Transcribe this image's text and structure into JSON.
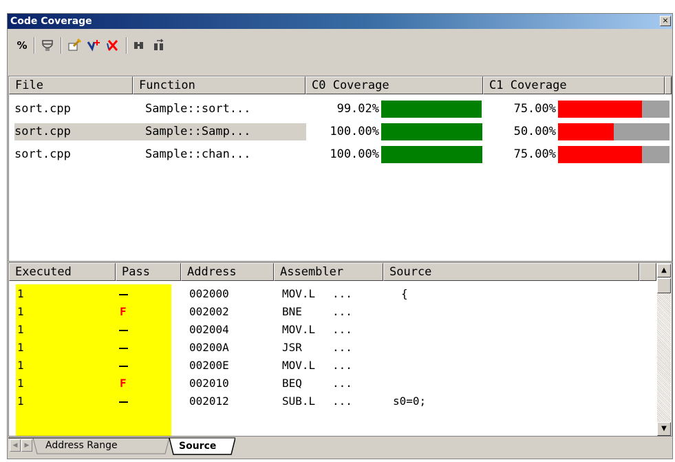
{
  "window": {
    "title": "Code Coverage",
    "close_glyph": "×"
  },
  "toolbar": {
    "buttons": [
      {
        "name": "percent-icon",
        "glyph": "%"
      },
      {
        "name": "coverage-range-icon",
        "glyph": "⛓"
      },
      {
        "name": "clear-coverage-icon",
        "glyph": "🧹"
      },
      {
        "name": "add-range-icon",
        "glyph": "+"
      },
      {
        "name": "delete-range-icon",
        "glyph": "✕"
      },
      {
        "name": "find-icon",
        "glyph": "🔭"
      },
      {
        "name": "find-next-icon",
        "glyph": "🔭"
      }
    ]
  },
  "upper": {
    "headers": [
      "File",
      "Function",
      "C0 Coverage",
      "C1 Coverage"
    ],
    "rows": [
      {
        "file": "sort.cpp",
        "function": "Sample::sort...",
        "c0": "99.02%",
        "c1": "75.00%",
        "c0_fill": 0.9902,
        "c1_fill": 0.75
      },
      {
        "file": "sort.cpp",
        "function": "Sample::Samp...",
        "c0": "100.00%",
        "c1": "50.00%",
        "c0_fill": 1.0,
        "c1_fill": 0.5
      },
      {
        "file": "sort.cpp",
        "function": "Sample::chan...",
        "c0": "100.00%",
        "c1": "75.00%",
        "c0_fill": 1.0,
        "c1_fill": 0.75
      }
    ],
    "colors": {
      "c0_bar": "#008000",
      "c1_bar": "#ff0000",
      "bar_track": "#a0a0a0"
    }
  },
  "lower": {
    "headers": [
      "Executed",
      "Pass",
      "Address",
      "Assembler",
      "Source"
    ],
    "rows": [
      {
        "executed": "1",
        "pass": "-",
        "address": "002000",
        "asm_op": "MOV.L",
        "asm_arg": "...",
        "source": "{"
      },
      {
        "executed": "1",
        "pass": "F",
        "address": "002002",
        "asm_op": "BNE",
        "asm_arg": "...",
        "source": ""
      },
      {
        "executed": "1",
        "pass": "-",
        "address": "002004",
        "asm_op": "MOV.L",
        "asm_arg": "...",
        "source": ""
      },
      {
        "executed": "1",
        "pass": "-",
        "address": "00200A",
        "asm_op": "JSR",
        "asm_arg": "...",
        "source": ""
      },
      {
        "executed": "1",
        "pass": "-",
        "address": "00200E",
        "asm_op": "MOV.L",
        "asm_arg": "...",
        "source": ""
      },
      {
        "executed": "1",
        "pass": "F",
        "address": "002010",
        "asm_op": "BEQ",
        "asm_arg": "...",
        "source": ""
      },
      {
        "executed": "1",
        "pass": "-",
        "address": "002012",
        "asm_op": "SUB.L",
        "asm_arg": "...",
        "source": "s0=0;"
      }
    ],
    "highlight": "#ffff00"
  },
  "tabs": {
    "items": [
      "Address Range",
      "Source"
    ],
    "active": "Source"
  }
}
